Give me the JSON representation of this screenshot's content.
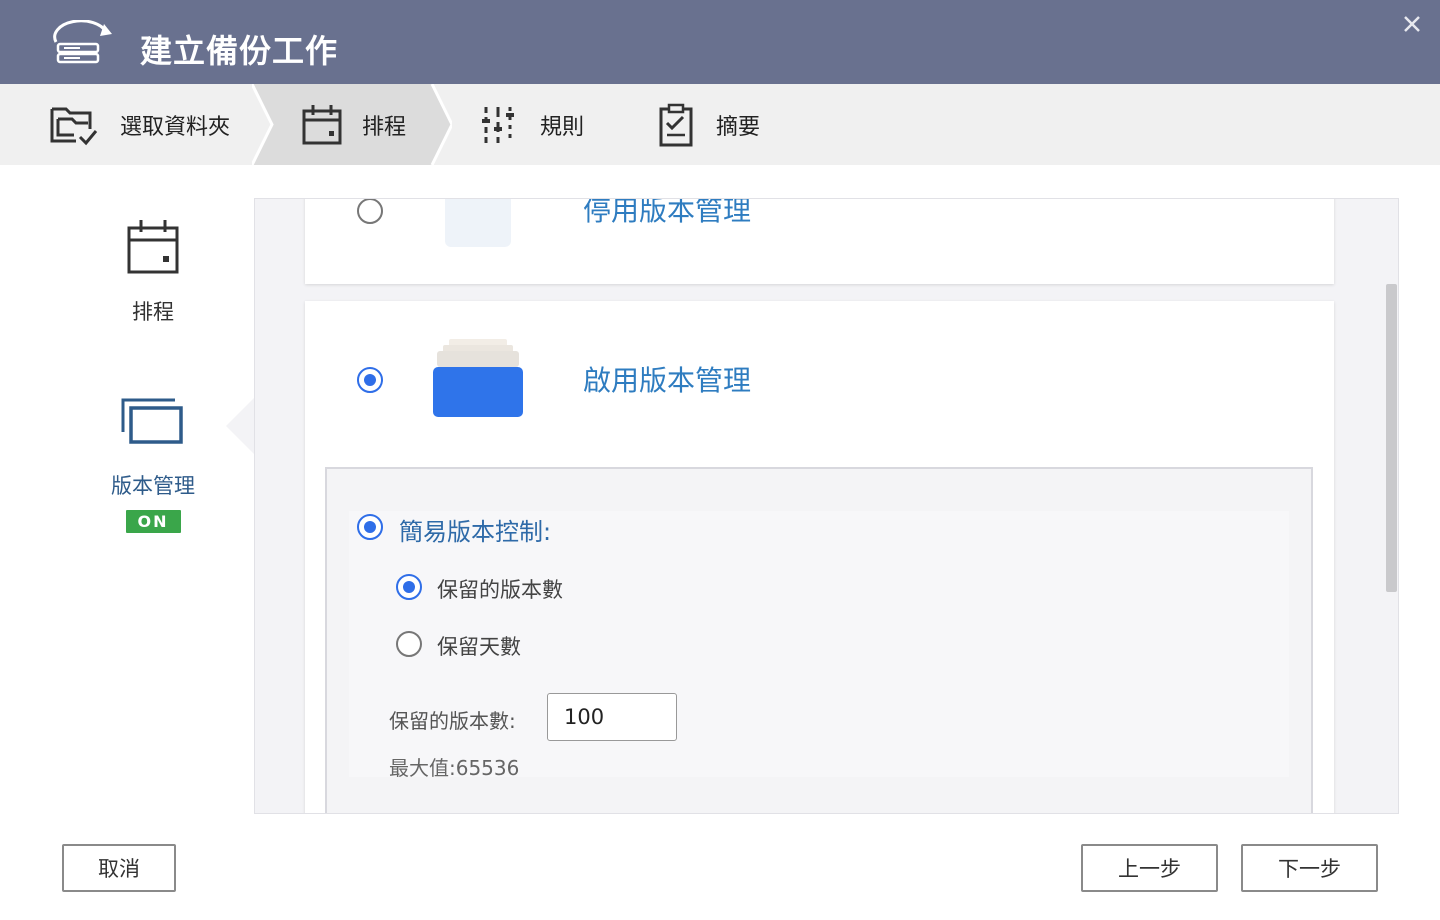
{
  "window": {
    "title": "建立備份工作",
    "title_bar_color": "#69718f",
    "icons": {
      "app": "backup-drive-icon",
      "close": "close-icon"
    }
  },
  "steps": [
    {
      "label": "選取資料夾",
      "icon": "folder-check-icon",
      "active": false
    },
    {
      "label": "排程",
      "icon": "calendar-icon",
      "active": true
    },
    {
      "label": "規則",
      "icon": "sliders-icon",
      "active": false
    },
    {
      "label": "摘要",
      "icon": "clipboard-check-icon",
      "active": false
    }
  ],
  "sidebar": {
    "items": [
      {
        "label": "排程",
        "icon": "calendar-icon",
        "selected": false
      },
      {
        "label": "版本管理",
        "icon": "versions-icon",
        "selected": true,
        "badge": "ON",
        "badge_color": "#3aa64a"
      }
    ]
  },
  "versioning": {
    "disable_option": {
      "label": "停用版本管理",
      "selected": false,
      "icon": "single-folder-icon"
    },
    "enable_option": {
      "label": "啟用版本管理",
      "selected": true,
      "icon": "stacked-folders-icon"
    },
    "accent_color": "#2f6ee8",
    "simple": {
      "label": "簡易版本控制:",
      "selected": true,
      "options": [
        {
          "label": "保留的版本數",
          "selected": true
        },
        {
          "label": "保留天數",
          "selected": false
        }
      ],
      "count_label": "保留的版本數:",
      "count_value": "100",
      "max_hint": "最大值:65536"
    }
  },
  "footer": {
    "cancel": "取消",
    "previous": "上一步",
    "next": "下一步"
  }
}
